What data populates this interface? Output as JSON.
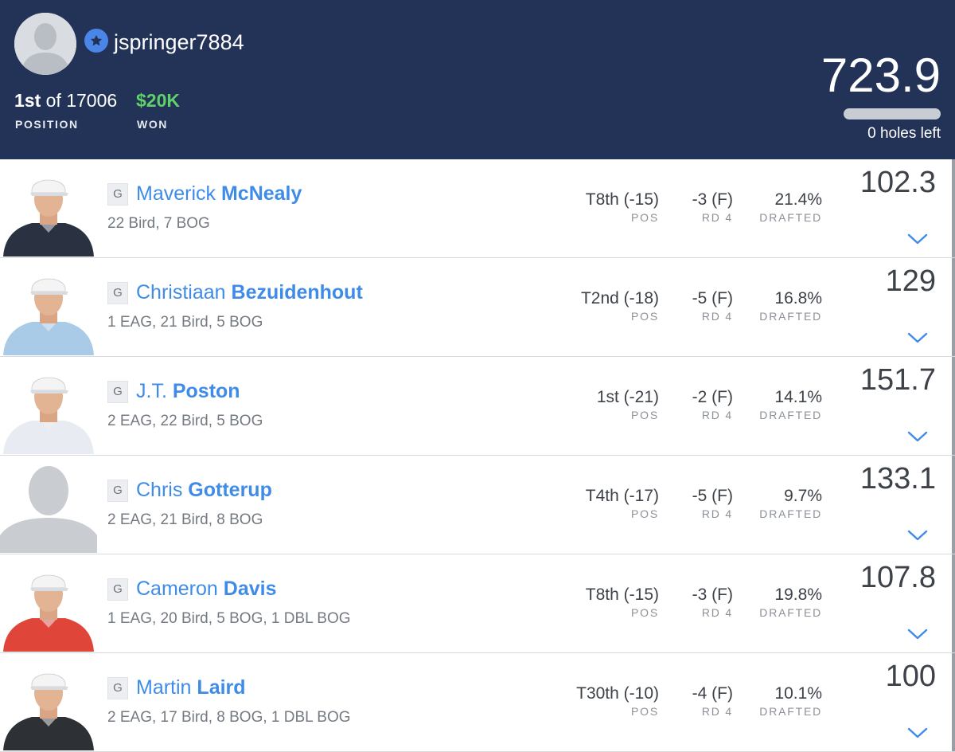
{
  "header": {
    "username": "jspringer7884",
    "rank_position": "1st",
    "rank_of_text": " of 17006",
    "position_label": "POSITION",
    "won_amount": "$20K",
    "won_label": "WON",
    "total_score": "723.9",
    "holes_left": "0 holes left",
    "progress_fraction": 1.0
  },
  "colors": {
    "header_bg": "#233357",
    "accent_blue": "#3f8ce8",
    "won_green": "#5fd06a"
  },
  "players": [
    {
      "position_code": "G",
      "first_name": "Maverick",
      "last_name": "McNealy",
      "stats": "22 Bird, 7 BOG",
      "pos_value": "T8th (-15)",
      "pos_label": "POS",
      "round_value": "-3 (F)",
      "round_label": "RD 4",
      "drafted_value": "21.4%",
      "drafted_label": "DRAFTED",
      "points": "102.3",
      "photo": "player-photo",
      "shirt_color": "#2a3140",
      "cap_color": "#f4f4f4"
    },
    {
      "position_code": "G",
      "first_name": "Christiaan",
      "last_name": "Bezuidenhout",
      "stats": "1 EAG, 21 Bird, 5 BOG",
      "pos_value": "T2nd (-18)",
      "pos_label": "POS",
      "round_value": "-5 (F)",
      "round_label": "RD 4",
      "drafted_value": "16.8%",
      "drafted_label": "DRAFTED",
      "points": "129",
      "photo": "player-photo",
      "shirt_color": "#a9cbe8",
      "cap_color": "#f4f4f4"
    },
    {
      "position_code": "G",
      "first_name": "J.T.",
      "last_name": "Poston",
      "stats": "2 EAG, 22 Bird, 5 BOG",
      "pos_value": "1st (-21)",
      "pos_label": "POS",
      "round_value": "-2 (F)",
      "round_label": "RD 4",
      "drafted_value": "14.1%",
      "drafted_label": "DRAFTED",
      "points": "151.7",
      "photo": "player-photo",
      "shirt_color": "#e8ecf2",
      "cap_color": "#f4f4f4"
    },
    {
      "position_code": "G",
      "first_name": "Chris",
      "last_name": "Gotterup",
      "stats": "2 EAG, 21 Bird, 8 BOG",
      "pos_value": "T4th (-17)",
      "pos_label": "POS",
      "round_value": "-5 (F)",
      "round_label": "RD 4",
      "drafted_value": "9.7%",
      "drafted_label": "DRAFTED",
      "points": "133.1",
      "photo": "placeholder-silhouette",
      "shirt_color": "#c9ccd1",
      "cap_color": "#c9ccd1"
    },
    {
      "position_code": "G",
      "first_name": "Cameron",
      "last_name": "Davis",
      "stats": "1 EAG, 20 Bird, 5 BOG, 1 DBL BOG",
      "pos_value": "T8th (-15)",
      "pos_label": "POS",
      "round_value": "-3 (F)",
      "round_label": "RD 4",
      "drafted_value": "19.8%",
      "drafted_label": "DRAFTED",
      "points": "107.8",
      "photo": "player-photo",
      "shirt_color": "#e0453a",
      "cap_color": "#f4f4f4"
    },
    {
      "position_code": "G",
      "first_name": "Martin",
      "last_name": "Laird",
      "stats": "2 EAG, 17 Bird, 8 BOG, 1 DBL BOG",
      "pos_value": "T30th (-10)",
      "pos_label": "POS",
      "round_value": "-4 (F)",
      "round_label": "RD 4",
      "drafted_value": "10.1%",
      "drafted_label": "DRAFTED",
      "points": "100",
      "photo": "player-photo",
      "shirt_color": "#2d3136",
      "cap_color": "#f4f4f4"
    }
  ]
}
